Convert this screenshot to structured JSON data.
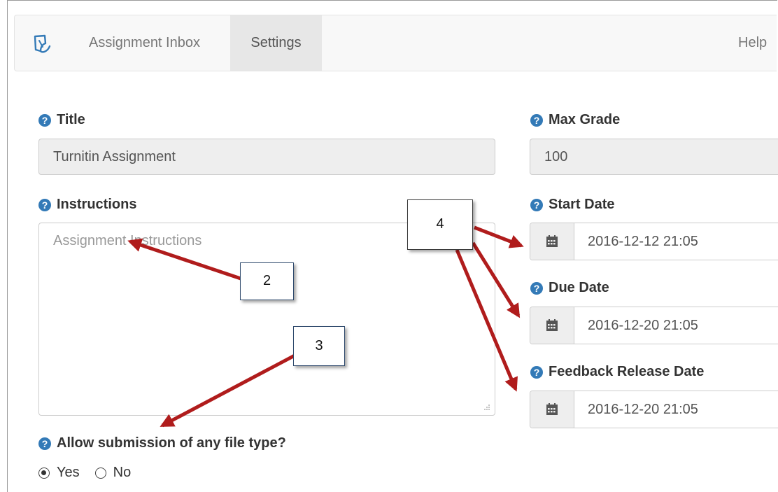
{
  "nav": {
    "items": [
      {
        "label": "Assignment Inbox"
      },
      {
        "label": "Settings"
      },
      {
        "label": "Help"
      }
    ]
  },
  "form": {
    "title": {
      "label": "Title",
      "value": "Turnitin Assignment"
    },
    "max_grade": {
      "label": "Max Grade",
      "value": "100"
    },
    "instructions": {
      "label": "Instructions",
      "placeholder": "Assignment Instructions"
    },
    "start_date": {
      "label": "Start Date",
      "value": "2016-12-12 21:05"
    },
    "due_date": {
      "label": "Due Date",
      "value": "2016-12-20 21:05"
    },
    "feedback_date": {
      "label": "Feedback Release Date",
      "value": "2016-12-20 21:05"
    },
    "file_type": {
      "label": "Allow submission of any file type?",
      "options": [
        {
          "label": "Yes",
          "selected": true
        },
        {
          "label": "No",
          "selected": false
        }
      ]
    }
  },
  "callouts": [
    "2",
    "3",
    "4"
  ],
  "colors": {
    "accent": "#337ab7",
    "arrow": "#b01c1c",
    "nav_active": "#e7e7e7"
  },
  "icons": {
    "help": "question-circle-icon",
    "calendar": "calendar-icon",
    "logo": "turnitin-logo-icon"
  }
}
